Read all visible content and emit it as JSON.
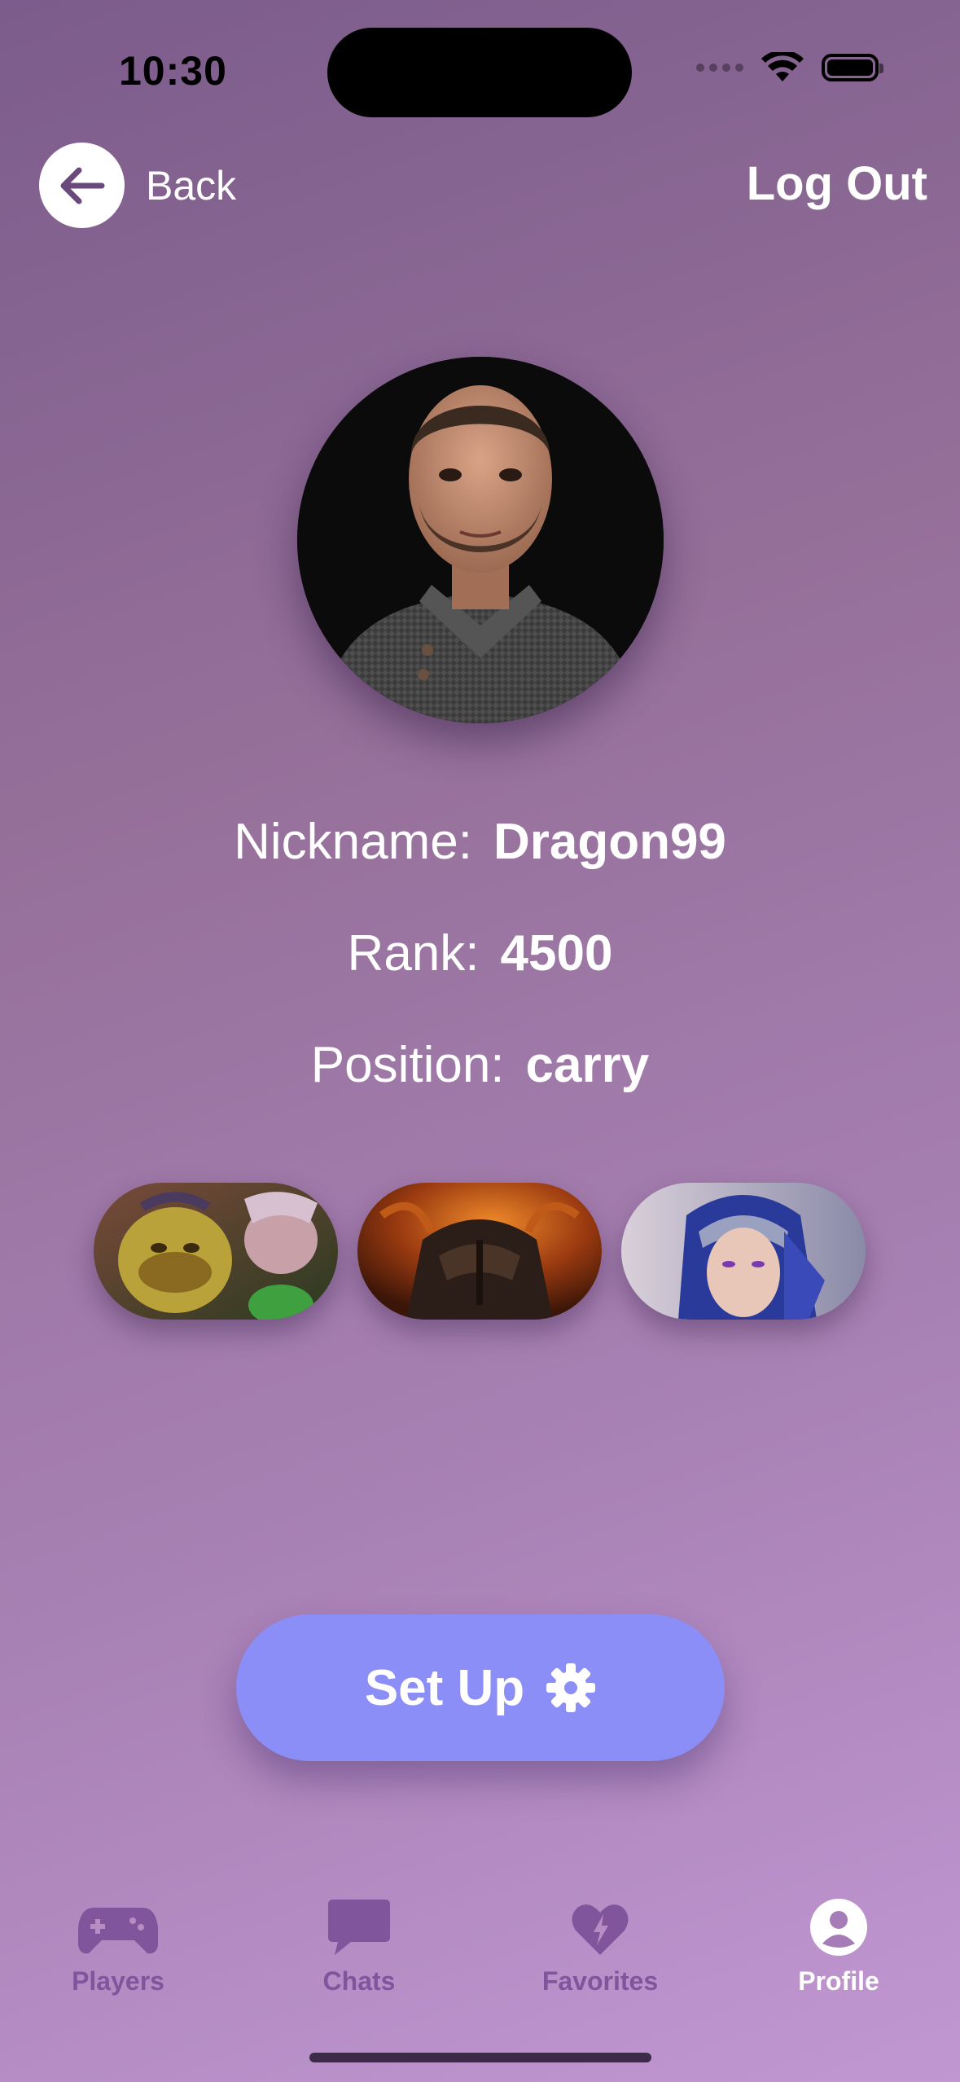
{
  "status_bar": {
    "time": "10:30"
  },
  "nav": {
    "back_label": "Back",
    "logout_label": "Log Out"
  },
  "profile": {
    "nickname_label": "Nickname:",
    "nickname_value": "Dragon99",
    "rank_label": "Rank:",
    "rank_value": "4500",
    "position_label": "Position:",
    "position_value": "carry"
  },
  "heroes": [
    {
      "icon": "hero-alchemist-portrait"
    },
    {
      "icon": "hero-chaos-knight-portrait"
    },
    {
      "icon": "hero-luna-portrait"
    }
  ],
  "setup": {
    "label": "Set Up",
    "icon": "gear-icon"
  },
  "tabs": [
    {
      "label": "Players",
      "icon": "gamepad-icon",
      "active": false
    },
    {
      "label": "Chats",
      "icon": "chat-bubble-icon",
      "active": false
    },
    {
      "label": "Favorites",
      "icon": "heart-bolt-icon",
      "active": false
    },
    {
      "label": "Profile",
      "icon": "person-circle-icon",
      "active": true
    }
  ],
  "colors": {
    "background_start": "#7c5c8c",
    "background_end": "#c197d2",
    "button": "#8b8ef6",
    "tab_inactive": "#80559c",
    "tab_active": "#ffffff"
  }
}
